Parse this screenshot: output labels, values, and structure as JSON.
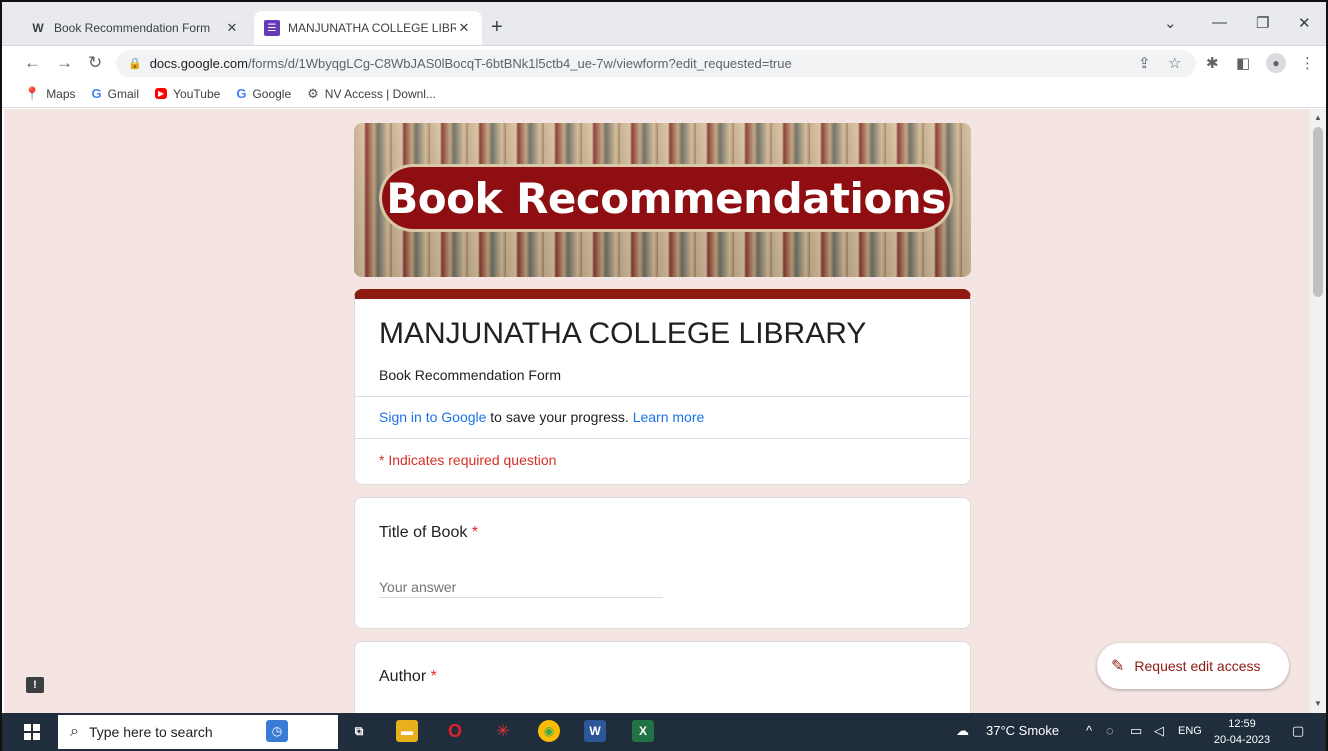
{
  "browser": {
    "tabs": [
      {
        "icon": "W",
        "title": "Book Recommendation Form",
        "close": "✕"
      },
      {
        "icon": "☰",
        "title": "MANJUNATHA COLLEGE LIBRAR",
        "close": "✕"
      }
    ],
    "new_tab": "+",
    "url_host": "docs.google.com",
    "url_path": "/forms/d/1WbyqgLCg-C8WbJAS0lBocqT-6btBNk1l5ctb4_ue-7w/viewform?edit_requested=true",
    "bookmarks": [
      {
        "icon": "location-pin-icon",
        "label": "Maps"
      },
      {
        "icon": "google-g-icon",
        "label": "Gmail"
      },
      {
        "icon": "youtube-icon",
        "label": "YouTube"
      },
      {
        "icon": "google-g-icon",
        "label": "Google"
      },
      {
        "icon": "gear-icon",
        "label": "NV Access | Downl..."
      }
    ]
  },
  "form": {
    "banner_text": "Book Recommendations",
    "title": "MANJUNATHA COLLEGE LIBRARY",
    "description": "Book Recommendation Form",
    "signin_link": "Sign in to Google",
    "signin_text": " to save your progress. ",
    "learn_more": "Learn more",
    "required_note": "* Indicates required question",
    "questions": [
      {
        "label": "Title of Book",
        "required_mark": " *",
        "placeholder": "Your answer"
      },
      {
        "label": "Author",
        "required_mark": " *"
      }
    ],
    "request_edit": "Request edit access",
    "accent": "#8e1a12",
    "background": "#f4e4e2"
  },
  "taskbar": {
    "search_placeholder": "Type here to search",
    "weather": "37°C  Smoke",
    "language": "ENG",
    "time": "12:59",
    "date": "20-04-2023"
  }
}
